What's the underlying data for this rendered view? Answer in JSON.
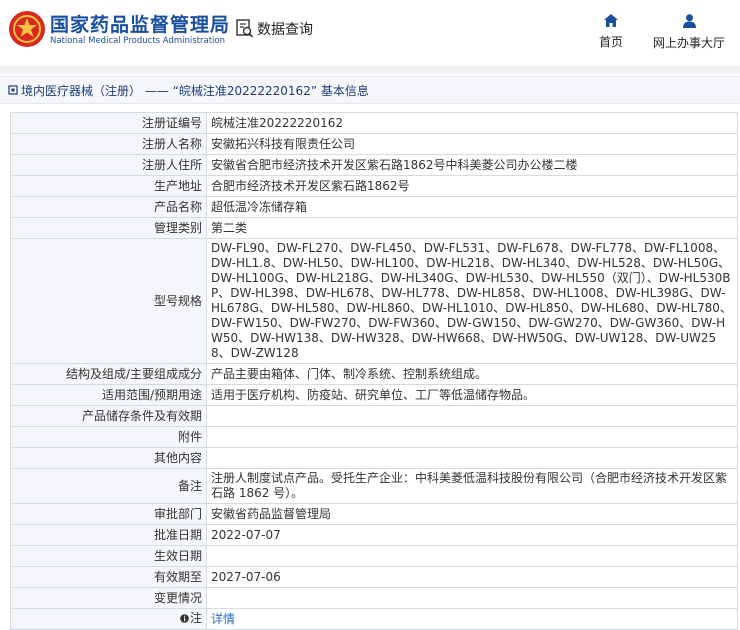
{
  "header": {
    "brand_cn": "国家药品监督管理局",
    "brand_en": "National Medical Products Administration",
    "query_label": "数据查询",
    "nav": {
      "home": "首页",
      "office": "网上办事大厅"
    },
    "accent": "#1a4fa0"
  },
  "title": "境内医疗器械（注册） —— “皖械注准20222220162” 基本信息",
  "rows": [
    {
      "key": "注册证编号",
      "value": "皖械注准20222220162"
    },
    {
      "key": "注册人名称",
      "value": "安徽拓兴科技有限责任公司"
    },
    {
      "key": "注册人住所",
      "value": "安徽省合肥市经济技术开发区紫石路1862号中科美菱公司办公楼二楼"
    },
    {
      "key": "生产地址",
      "value": "合肥市经济技术开发区紫石路1862号"
    },
    {
      "key": "产品名称",
      "value": "超低温冷冻储存箱"
    },
    {
      "key": "管理类别",
      "value": "第二类"
    },
    {
      "key": "型号规格",
      "value": "DW-FL90、DW-FL270、DW-FL450、DW-FL531、DW-FL678、DW-FL778、DW-FL1008、DW-HL1.8、DW-HL50、DW-HL100、DW-HL218、DW-HL340、DW-HL528、DW-HL50G、DW-HL100G、DW-HL218G、DW-HL340G、DW-HL530、DW-HL550（双门）、DW-HL530BP、DW-HL398、DW-HL678、DW-HL778、DW-HL858、DW-HL1008、DW-HL398G、DW-HL678G、DW-HL580、DW-HL860、DW-HL1010、DW-HL850、DW-HL680、DW-HL780、DW-FW150、DW-FW270、DW-FW360、DW-GW150、DW-GW270、DW-GW360、DW-HW50、DW-HW138、DW-HW328、DW-HW668、DW-HW50G、DW-UW128、DW-UW258、DW-ZW128"
    },
    {
      "key": "结构及组成/主要组成成分",
      "value": "产品主要由箱体、门体、制冷系统、控制系统组成。"
    },
    {
      "key": "适用范围/预期用途",
      "value": "适用于医疗机构、防疫站、研究单位、工厂等低温储存物品。"
    },
    {
      "key": "产品储存条件及有效期",
      "value": ""
    },
    {
      "key": "附件",
      "value": ""
    },
    {
      "key": "其他内容",
      "value": ""
    },
    {
      "key": "备注",
      "value": "注册人制度试点产品。受托生产企业：中科美菱低温科技股份有限公司（合肥市经济技术开发区紫石路 1862 号）。"
    },
    {
      "key": "审批部门",
      "value": "安徽省药品监督管理局"
    },
    {
      "key": "批准日期",
      "value": "2022-07-07"
    },
    {
      "key": "生效日期",
      "value": ""
    },
    {
      "key": "有效期至",
      "value": "2027-07-06"
    },
    {
      "key": "变更情况",
      "value": ""
    }
  ],
  "note": {
    "key": "注",
    "link": "详情",
    "icon": "info-icon"
  }
}
